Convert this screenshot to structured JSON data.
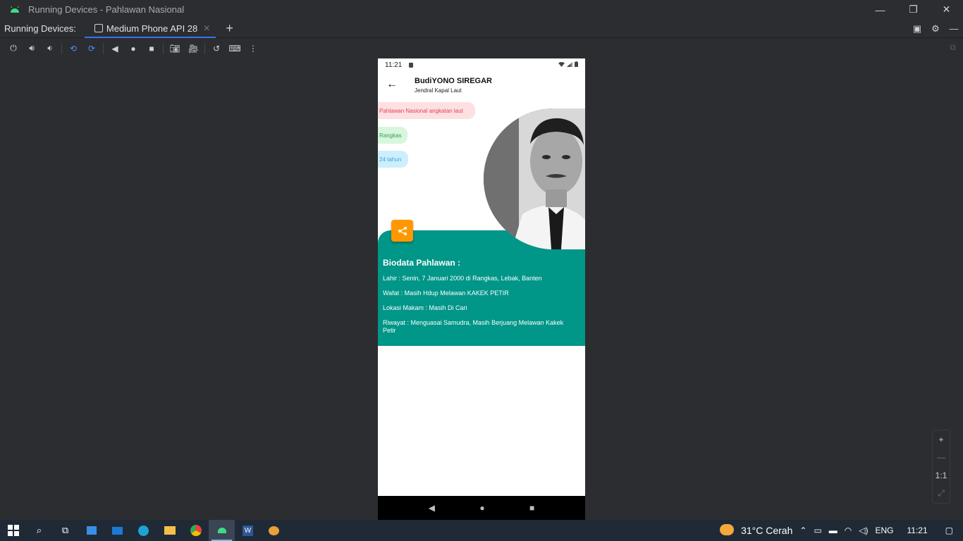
{
  "window": {
    "title": "Running Devices - Pahlawan Nasional",
    "minimize": "—",
    "restore": "❐",
    "close": "✕"
  },
  "tabs": {
    "label": "Running Devices:",
    "active_tab": "Medium Phone API 28",
    "close": "✕",
    "add": "+"
  },
  "toolbar": {
    "icons": [
      "power-icon",
      "volume-up-icon",
      "volume-down-icon",
      "rotate-left-icon",
      "rotate-right-icon",
      "back-icon",
      "home-icon",
      "overview-icon",
      "screenshot-icon",
      "screenrecord-icon",
      "reset-icon",
      "keyboard-icon",
      "more-icon"
    ]
  },
  "phone": {
    "status": {
      "time": "11:21"
    },
    "appbar": {
      "back": "←",
      "name": "BudiYONO SIREGAR",
      "subtitle": "Jendral Kapal Laut"
    },
    "chips": {
      "rank": "Pahlawan Nasional angkatan laut",
      "place": "Rangkas",
      "age": "24 tahun"
    },
    "bio": {
      "heading": "Biodata Pahlawan :",
      "lahir": "Lahir : Senin, 7 Januari 2000 di Rangkas, Lebak, Banten",
      "wafat": "Wafat : Masih Hdup Melawan KAKEK PETIR",
      "makam": "Lokasi Makam : Masih Di Cari",
      "riwayat": "Riwayat : Menguasai Samudra, Masih Berjuang Melawan Kakek Petir"
    },
    "nav": {
      "back": "◀",
      "home": "●",
      "recents": "■"
    }
  },
  "zoom": {
    "in": "+",
    "out": "—",
    "actual": "1:1",
    "fit": "⤢"
  },
  "taskbar": {
    "weather": "31°C  Cerah",
    "lang": "ENG",
    "time": "11:21"
  },
  "colors": {
    "accent": "#3574f0",
    "teal": "#009688",
    "fab": "#ff9800"
  }
}
